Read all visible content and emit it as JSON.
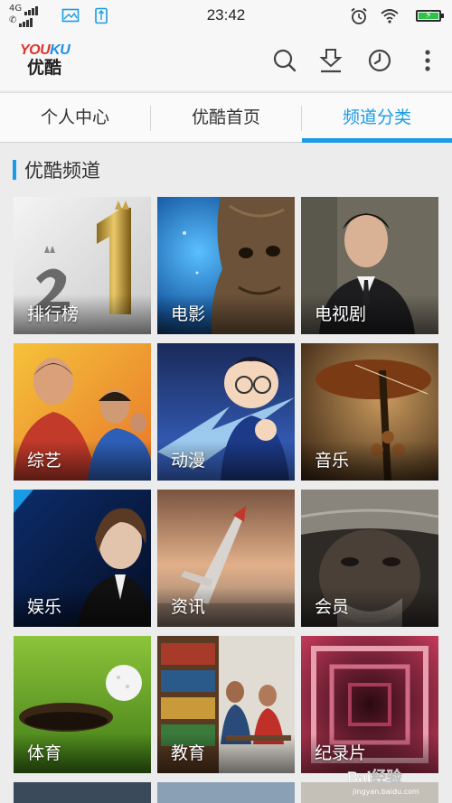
{
  "status_bar": {
    "network_type": "4G",
    "time": "23:42"
  },
  "header": {
    "logo_text": "YOUKU",
    "logo_text_cn": "优酷",
    "icons": [
      "search-icon",
      "download-icon",
      "history-icon",
      "more-icon"
    ]
  },
  "tabs": [
    {
      "label": "个人中心",
      "active": false
    },
    {
      "label": "优酷首页",
      "active": false
    },
    {
      "label": "频道分类",
      "active": true
    }
  ],
  "section": {
    "title": "优酷频道"
  },
  "channels": [
    {
      "label": "排行榜"
    },
    {
      "label": "电影"
    },
    {
      "label": "电视剧"
    },
    {
      "label": "综艺"
    },
    {
      "label": "动漫"
    },
    {
      "label": "音乐"
    },
    {
      "label": "娱乐"
    },
    {
      "label": "资讯"
    },
    {
      "label": "会员"
    },
    {
      "label": "体育"
    },
    {
      "label": "教育"
    },
    {
      "label": "纪录片"
    }
  ],
  "watermark": {
    "text": "Bai经验",
    "subtext": "jingyan.baidu.com"
  },
  "colors": {
    "accent": "#1a9be6",
    "logo_red": "#e0312d",
    "logo_blue": "#1c8fe8",
    "battery_green": "#2ec24a"
  }
}
